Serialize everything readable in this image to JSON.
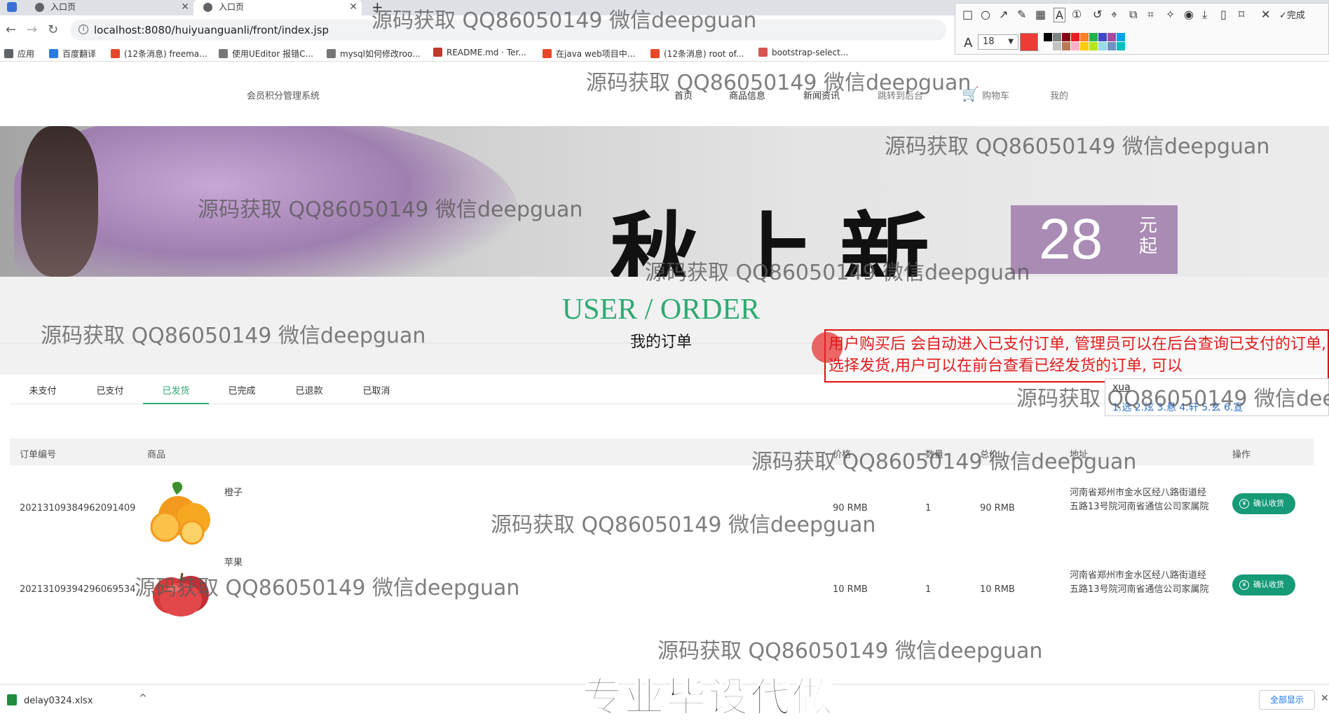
{
  "browser": {
    "tabs": [
      {
        "title": "入口页"
      },
      {
        "title": "入口页"
      }
    ],
    "url": "localhost:8080/huiyuanguanli/front/index.jsp",
    "bookmarks": [
      {
        "label": "应用",
        "color": "#5f6368"
      },
      {
        "label": "百度翻译",
        "color": "#2a7ae2"
      },
      {
        "label": "(12条消息) freema...",
        "color": "#e8462a"
      },
      {
        "label": "使用UEditor 报错C...",
        "color": "#777777"
      },
      {
        "label": "mysql如何修改roo...",
        "color": "#777777"
      },
      {
        "label": "README.md · Ter...",
        "color": "#c0392b"
      },
      {
        "label": "在java web项目中...",
        "color": "#e8462a"
      },
      {
        "label": "(12条消息) root of...",
        "color": "#e8462a"
      },
      {
        "label": "bootstrap-select...",
        "color": "#d9534f"
      }
    ]
  },
  "annotation_tool": {
    "font_size": "18",
    "current_color": "#ee3b35",
    "done_label": "完成",
    "swatches": [
      "#000000",
      "#7f7f7f",
      "#880015",
      "#ed1c24",
      "#ff7f27",
      "#22b14c",
      "#3f48cc",
      "#a349a4",
      "#00a2e8",
      "#ffffff",
      "#c3c3c3",
      "#b97a57",
      "#ffaec9",
      "#ffc90e",
      "#b5e61d",
      "#99d9ea",
      "#7092be",
      "#00c0c0"
    ]
  },
  "site": {
    "name": "会员积分管理系统",
    "nav": [
      {
        "label": "首页"
      },
      {
        "label": "商品信息"
      },
      {
        "label": "新闻资讯"
      },
      {
        "label": "跳转到后台"
      },
      {
        "label": "购物车"
      },
      {
        "label": "我的"
      }
    ],
    "banner": {
      "slogan": "秋上新",
      "price": "28",
      "price_unit": "元起"
    }
  },
  "section": {
    "title": "USER / ORDER",
    "subtitle": "我的订单"
  },
  "order_tabs": {
    "items": [
      "未支付",
      "已支付",
      "已发货",
      "已完成",
      "已退款",
      "已取消"
    ],
    "active": "已发货"
  },
  "orders_table": {
    "headers": [
      "订单编号",
      "商品",
      "价格",
      "数量",
      "总价",
      "地址",
      "操作"
    ],
    "rows": [
      {
        "id": "20213109384962091409",
        "product": "橙子",
        "price": "90 RMB",
        "qty": "1",
        "total": "90 RMB",
        "address": "河南省郑州市金水区经八路街道经五路13号院河南省通信公司家属院",
        "action": "确认收货",
        "fruit": "orange"
      },
      {
        "id": "20213109394296069534",
        "product": "苹果",
        "price": "10 RMB",
        "qty": "1",
        "total": "10 RMB",
        "address": "河南省郑州市金水区经八路街道经五路13号院河南省通信公司家属院",
        "action": "确认收货",
        "fruit": "apple"
      }
    ]
  },
  "annotation": {
    "text": "用户购买后  会自动进入已支付订单, 管理员可以在后台查询已支付的订单, 选择发货,用户可以在前台查看已经发货的订单, 可以",
    "ime_composition": "xua",
    "ime_candidates": "1.选  2.炫  3.悬  4.轩  5.玄  6.宣"
  },
  "watermark": "源码获取 QQ86050149 微信deepguan",
  "download": {
    "filename": "delay0324.xlsx",
    "show_all": "全部显示"
  },
  "caption": "专业毕设代做"
}
